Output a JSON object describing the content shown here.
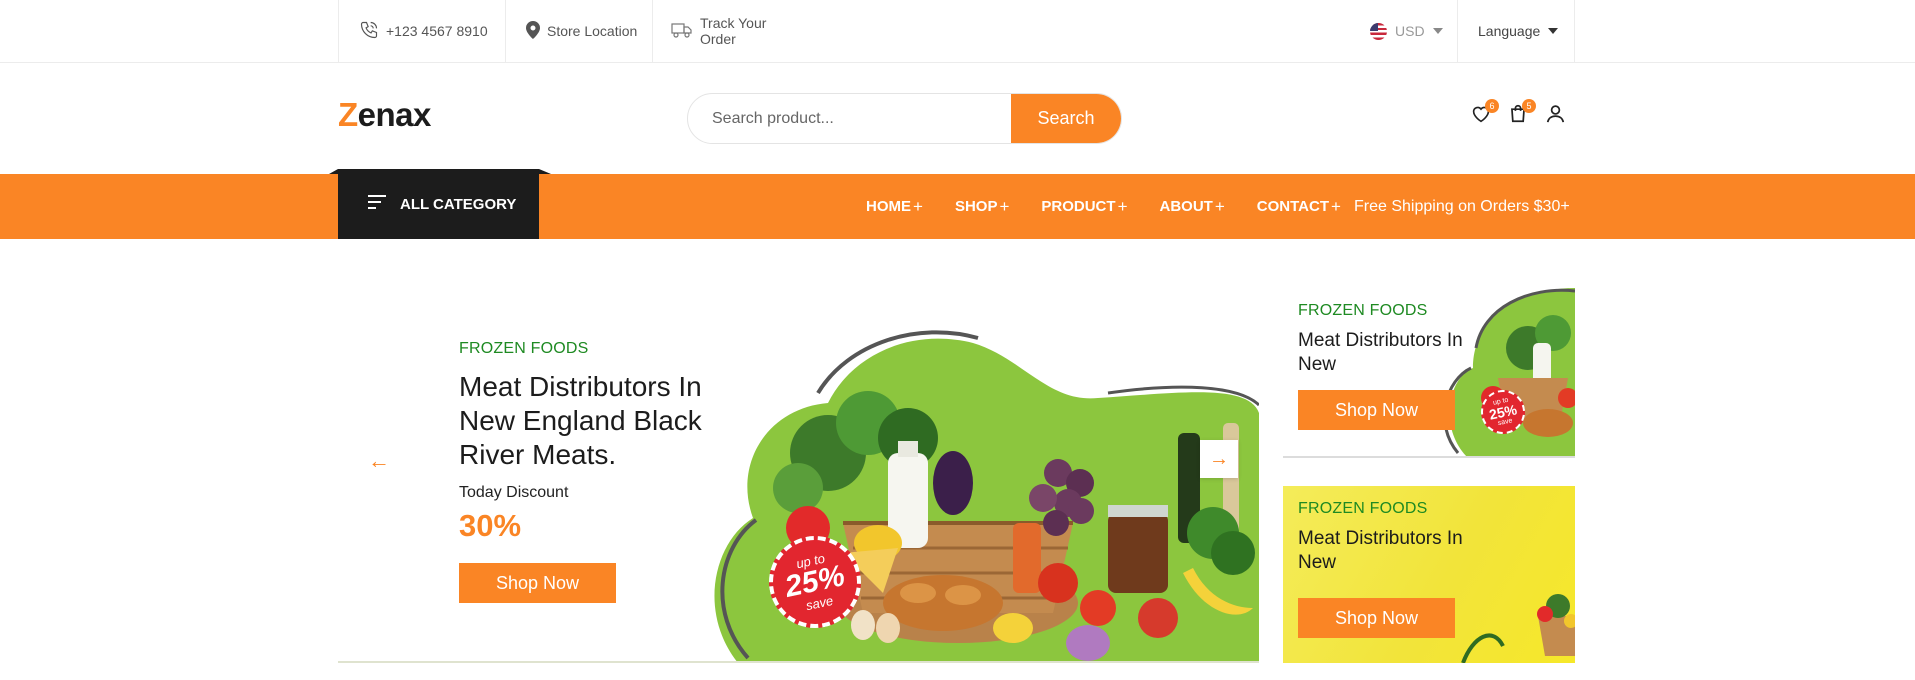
{
  "topbar": {
    "phone": "+123 4567 8910",
    "store": "Store Location",
    "track": "Track Your Order",
    "currency": "USD",
    "language": "Language"
  },
  "header": {
    "logo_first": "Z",
    "logo_rest": "enax",
    "search_placeholder": "Search product...",
    "search_button": "Search",
    "wishlist_count": "6",
    "cart_count": "5"
  },
  "nav": {
    "all_category": "ALL CATEGORY",
    "items": [
      {
        "label": "HOME",
        "plus": "+"
      },
      {
        "label": "SHOP",
        "plus": "+"
      },
      {
        "label": "PRODUCT",
        "plus": "+"
      },
      {
        "label": "ABOUT",
        "plus": "+"
      },
      {
        "label": "CONTACT",
        "plus": "+"
      }
    ],
    "free_shipping": "Free Shipping on Orders $30+"
  },
  "hero": {
    "category": "FROZEN FOODS",
    "title": "Meat Distributors In New England Black River Meats.",
    "subtitle": "Today Discount",
    "discount": "30%",
    "button": "Shop Now",
    "sticker_top": "up to",
    "sticker_pct": "25%",
    "sticker_bottom": "save",
    "prev_arrow": "←",
    "next_arrow": "→"
  },
  "side_banners": [
    {
      "category": "FROZEN FOODS",
      "title": "Meat Distributors In New",
      "button": "Shop Now",
      "sticker_top": "up to",
      "sticker_pct": "25%",
      "sticker_bottom": "save"
    },
    {
      "category": "FROZEN FOODS",
      "title": "Meat Distributors In New",
      "button": "Shop Now"
    }
  ],
  "colors": {
    "accent": "#fa8525",
    "dark": "#1c1c1c",
    "green_label": "#1e8a22",
    "hero_green": "#8cc63e"
  },
  "icons": [
    "phone-icon",
    "map-pin-icon",
    "truck-icon",
    "us-flag-icon",
    "heart-icon",
    "bag-icon",
    "user-icon",
    "menu-icon"
  ]
}
